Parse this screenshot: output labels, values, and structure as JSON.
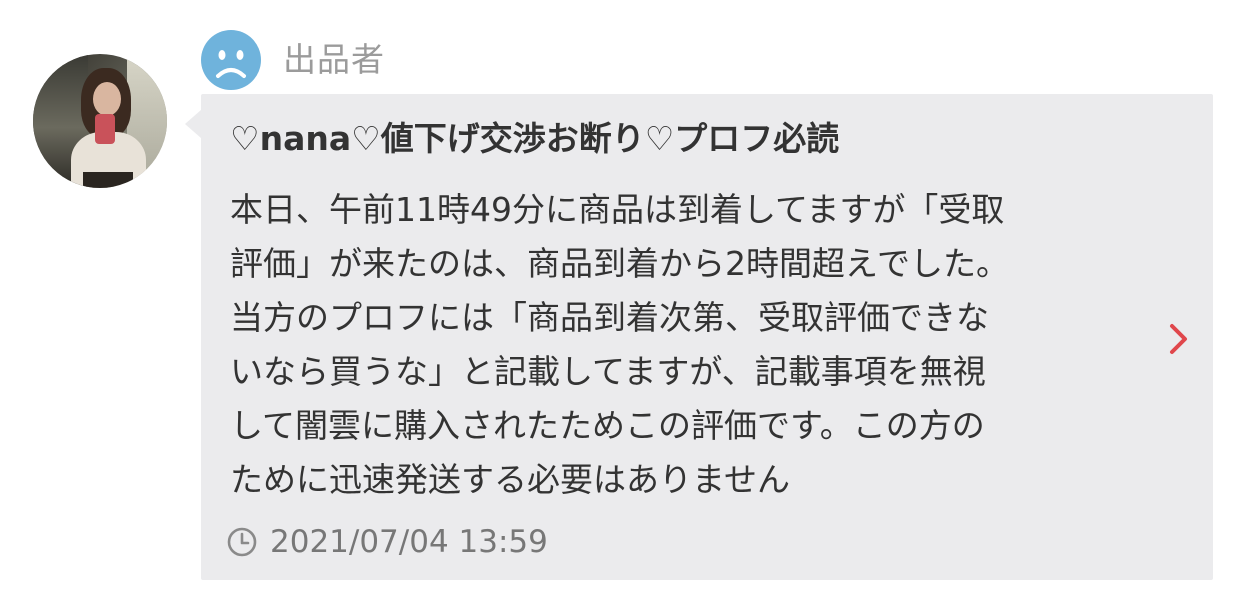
{
  "seller": {
    "role_label": "出品者",
    "name": "♡nana♡値下げ交渉お断り♡プロフ必読",
    "avatar_icon": "user-photo",
    "rating_icon": "sad-face-icon",
    "rating_color": "#6fb3dc"
  },
  "review": {
    "message": "本日、午前11時49分に商品は到着してますが「受取\n評価」が来たのは、商品到着から2時間超えでした。\n当方のプロフには「商品到着次第、受取評価できな\nいなら買うな」と記載してますが、記載事項を無視\nして闇雲に購入されたためこの評価です。この方の\nために迅速発送する必要はありません",
    "timestamp": "2021/07/04 13:59",
    "timestamp_icon": "clock-icon",
    "chevron_icon": "chevron-right-icon",
    "accent_color": "#e0474c",
    "bubble_color": "#ebebed"
  }
}
